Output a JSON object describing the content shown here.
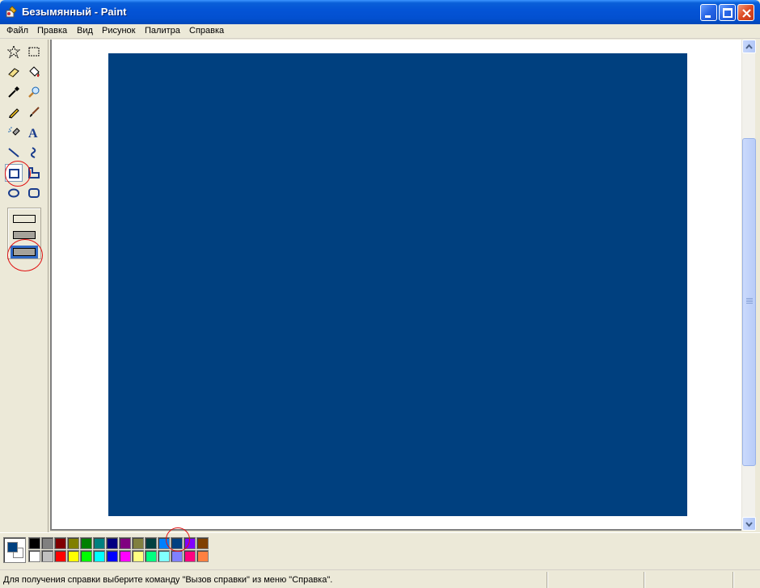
{
  "window": {
    "title": "Безымянный - Paint"
  },
  "menu": {
    "items": [
      "Файл",
      "Правка",
      "Вид",
      "Рисунок",
      "Палитра",
      "Справка"
    ]
  },
  "toolbox": {
    "tools": [
      "free-form-select-icon",
      "rect-select-icon",
      "eraser-icon",
      "fill-bucket-icon",
      "color-picker-icon",
      "magnifier-icon",
      "pencil-icon",
      "brush-icon",
      "airbrush-icon",
      "text-icon",
      "line-icon",
      "curve-icon",
      "rectangle-icon",
      "polygon-icon",
      "ellipse-icon",
      "rounded-rect-icon"
    ],
    "selected_tool": "rectangle-icon",
    "fill_options": [
      "outline",
      "outline-fill",
      "fill-only"
    ],
    "selected_fill_option": "fill-only"
  },
  "canvas": {
    "drawn_shape_color": "#00407f"
  },
  "palette": {
    "foreground": "#00407f",
    "background": "#ffffff",
    "row1": [
      "#000000",
      "#808080",
      "#800000",
      "#808000",
      "#008000",
      "#008080",
      "#000080",
      "#800080",
      "#808040",
      "#004040",
      "#0080ff",
      "#004080",
      "#8000ff",
      "#804000"
    ],
    "row2": [
      "#ffffff",
      "#c0c0c0",
      "#ff0000",
      "#ffff00",
      "#00ff00",
      "#00ffff",
      "#0000ff",
      "#ff00ff",
      "#ffff80",
      "#00ff80",
      "#80ffff",
      "#8080ff",
      "#ff0080",
      "#ff8040"
    ]
  },
  "status": {
    "help_text": "Для получения справки выберите команду \"Вызов справки\" из меню \"Справка\"."
  }
}
